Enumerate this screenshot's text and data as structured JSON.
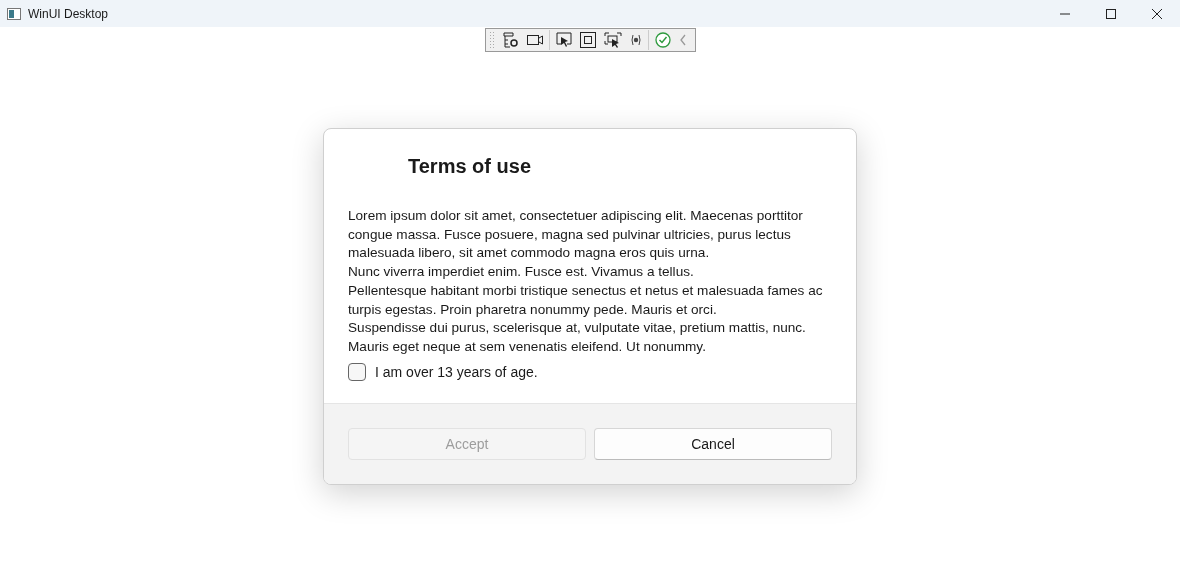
{
  "window": {
    "title": "WinUI Desktop"
  },
  "toolbar": {
    "tools": [
      {
        "kind": "live-tree"
      },
      {
        "kind": "camera"
      },
      {
        "kind": "select"
      },
      {
        "kind": "layout"
      },
      {
        "kind": "focus"
      },
      {
        "kind": "binding"
      },
      {
        "kind": "check"
      },
      {
        "kind": "collapse"
      }
    ]
  },
  "dialog": {
    "title": "Terms of use",
    "paragraphs": [
      "Lorem ipsum dolor sit amet, consectetuer adipiscing elit. Maecenas porttitor congue massa. Fusce posuere, magna sed pulvinar ultricies, purus lectus malesuada libero, sit amet commodo magna eros quis urna.",
      "Nunc viverra imperdiet enim. Fusce est. Vivamus a tellus.",
      "Pellentesque habitant morbi tristique senectus et netus et malesuada fames ac turpis egestas. Proin pharetra nonummy pede. Mauris et orci.",
      "Suspendisse dui purus, scelerisque at, vulputate vitae, pretium mattis, nunc. Mauris eget neque at sem venenatis eleifend. Ut nonummy."
    ],
    "checkbox": {
      "label": "I am over 13 years of age.",
      "checked": false
    },
    "buttons": [
      {
        "label": "Accept",
        "disabled": true
      },
      {
        "label": "Cancel",
        "disabled": false
      }
    ]
  }
}
